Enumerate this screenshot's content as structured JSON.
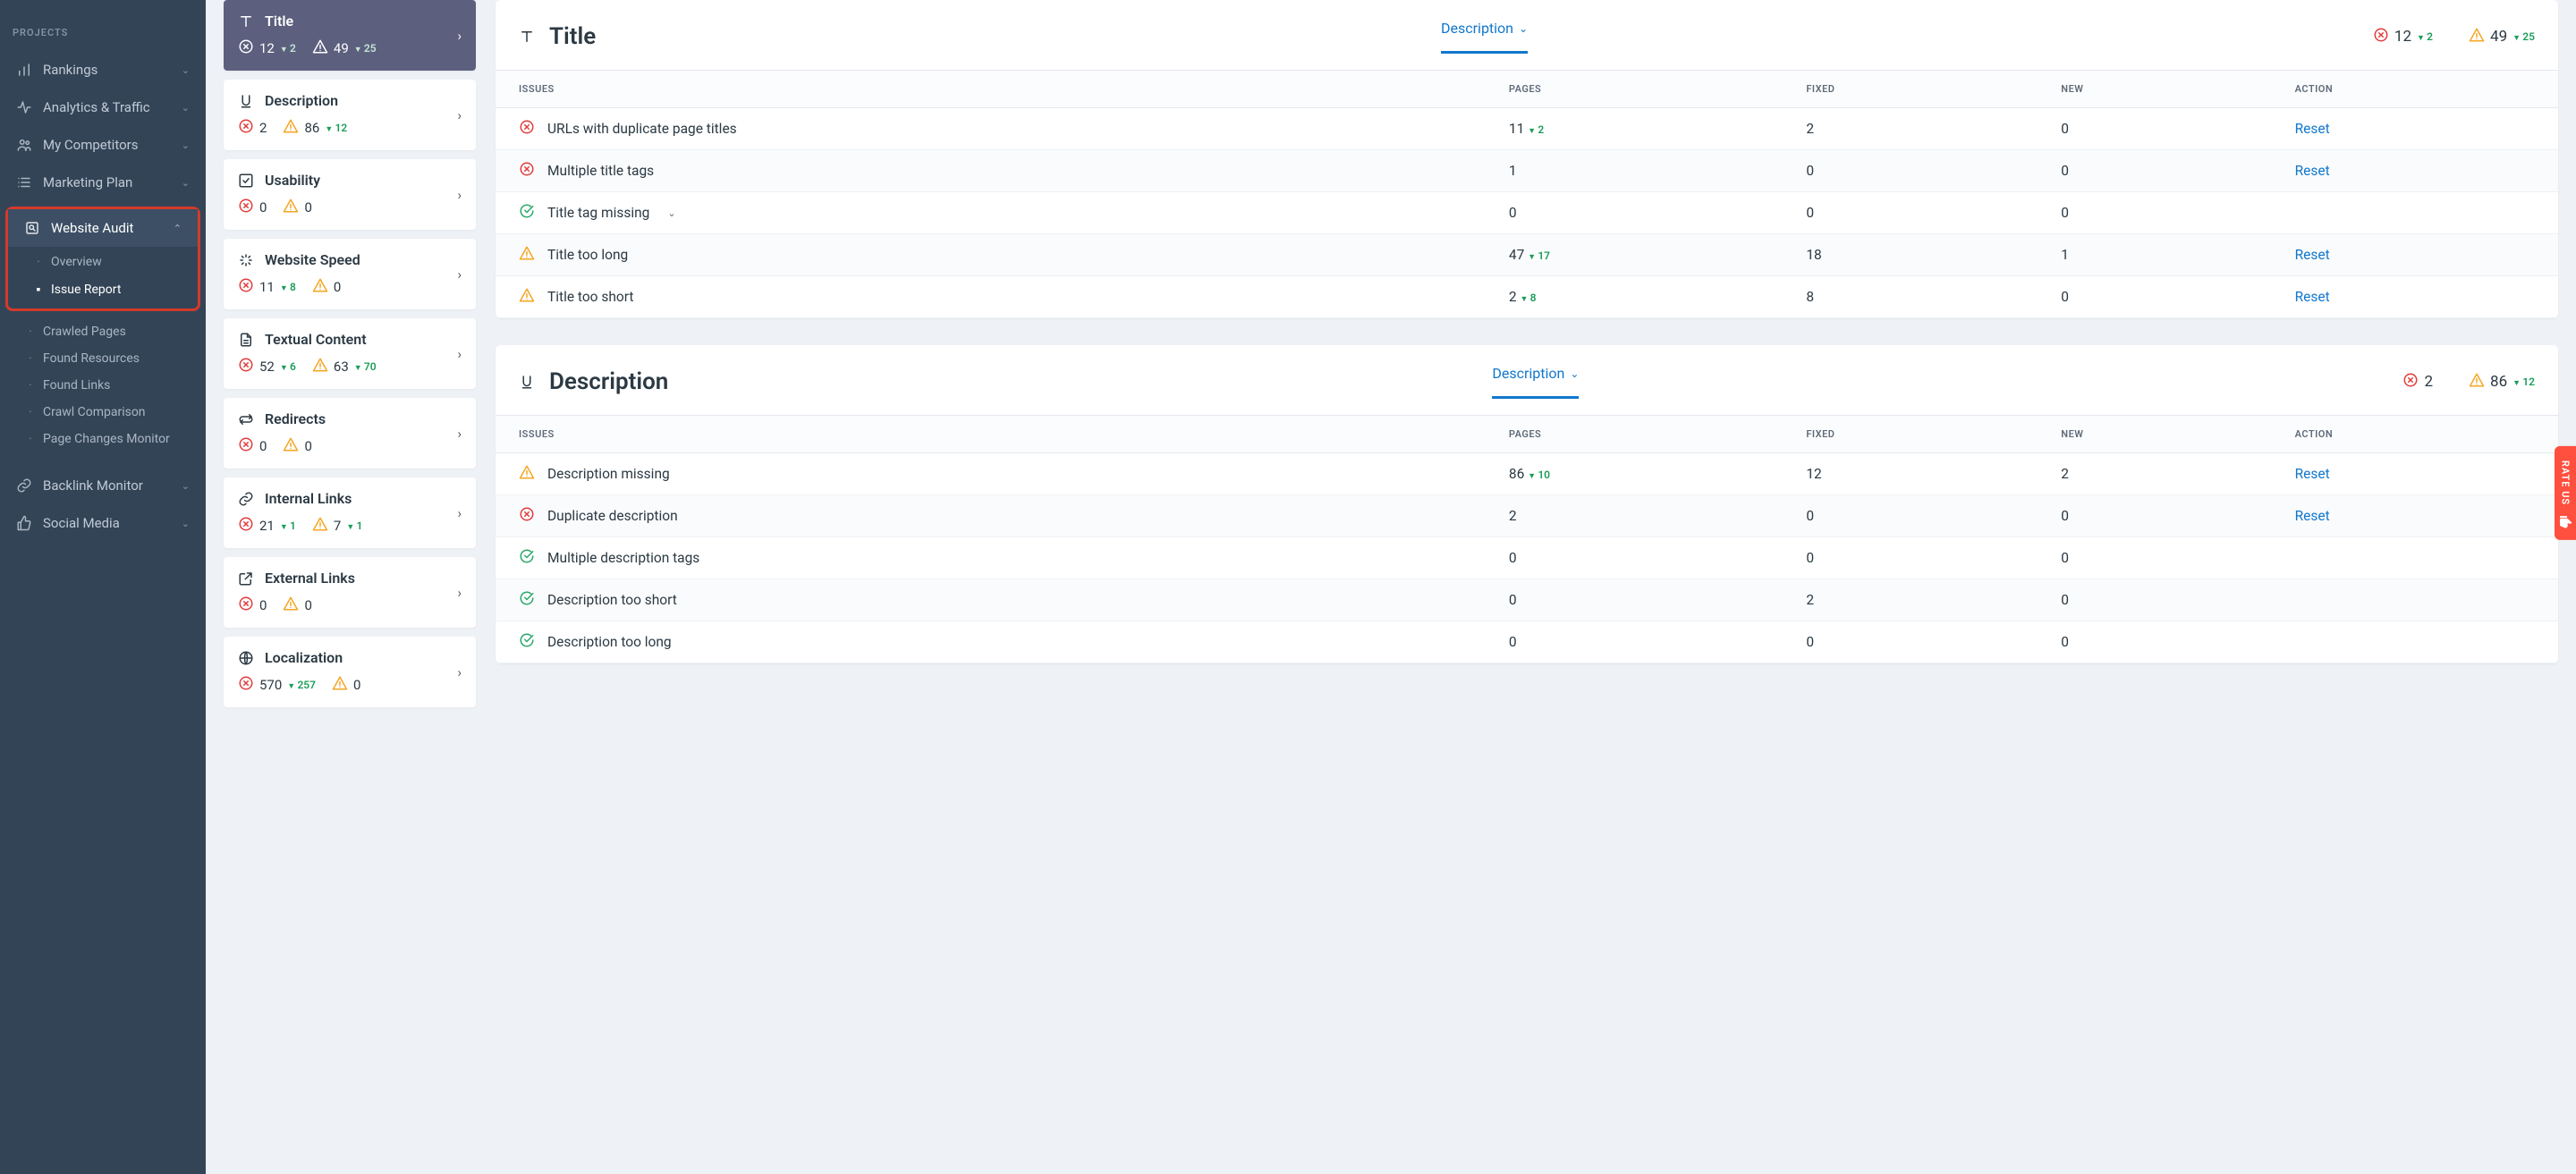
{
  "sidebar": {
    "heading": "PROJECTS",
    "items": [
      {
        "label": "Rankings",
        "icon": "bars"
      },
      {
        "label": "Analytics & Traffic",
        "icon": "pulse"
      },
      {
        "label": "My Competitors",
        "icon": "people"
      },
      {
        "label": "Marketing Plan",
        "icon": "list"
      },
      {
        "label": "Website Audit",
        "icon": "audit",
        "expanded": true,
        "active": true
      },
      {
        "label": "Backlink Monitor",
        "icon": "link"
      },
      {
        "label": "Social Media",
        "icon": "thumb"
      }
    ],
    "audit_sub": [
      {
        "label": "Overview"
      },
      {
        "label": "Issue Report",
        "selected": true
      },
      {
        "label": "Crawled Pages"
      },
      {
        "label": "Found Resources"
      },
      {
        "label": "Found Links"
      },
      {
        "label": "Crawl Comparison"
      },
      {
        "label": "Page Changes Monitor"
      }
    ]
  },
  "categories": [
    {
      "key": "title",
      "icon": "T",
      "title": "Title",
      "err": 12,
      "err_d": 2,
      "warn": 49,
      "warn_d": 25,
      "active": true
    },
    {
      "key": "description",
      "icon": "U",
      "title": "Description",
      "err": 2,
      "warn": 86,
      "warn_d": 12
    },
    {
      "key": "usability",
      "icon": "check",
      "title": "Usability",
      "err": 0,
      "warn": 0
    },
    {
      "key": "speed",
      "icon": "speed",
      "title": "Website Speed",
      "err": 11,
      "err_d": 8,
      "warn": 0
    },
    {
      "key": "text",
      "icon": "doc",
      "title": "Textual Content",
      "err": 52,
      "err_d": 6,
      "warn": 63,
      "warn_d": 70
    },
    {
      "key": "redirects",
      "icon": "redir",
      "title": "Redirects",
      "err": 0,
      "warn": 0
    },
    {
      "key": "ilinks",
      "icon": "link",
      "title": "Internal Links",
      "err": 21,
      "err_d": 1,
      "warn": 7,
      "warn_d": 1
    },
    {
      "key": "elinks",
      "icon": "ext",
      "title": "External Links",
      "err": 0,
      "warn": 0
    },
    {
      "key": "local",
      "icon": "globe",
      "title": "Localization",
      "err": 570,
      "err_d": 257,
      "warn": 0
    }
  ],
  "sections": [
    {
      "title": "Title",
      "icon": "T",
      "tab": "Description",
      "stats": {
        "err": 12,
        "err_d": 2,
        "warn": 49,
        "warn_d": 25
      },
      "columns": [
        "ISSUES",
        "PAGES",
        "FIXED",
        "NEW",
        "ACTION"
      ],
      "rows": [
        {
          "sev": "err",
          "name": "URLs with duplicate page titles",
          "pages": "11",
          "pages_d": 2,
          "fixed": "2",
          "new": "0",
          "action": "Reset"
        },
        {
          "sev": "err",
          "name": "Multiple title tags",
          "pages": "1",
          "fixed": "0",
          "new": "0",
          "action": "Reset"
        },
        {
          "sev": "ok",
          "name": "Title tag missing",
          "expandable": true,
          "pages": "0",
          "fixed": "0",
          "new": "0",
          "action": ""
        },
        {
          "sev": "warn",
          "name": "Title too long",
          "pages": "47",
          "pages_d": 17,
          "fixed": "18",
          "new": "1",
          "action": "Reset"
        },
        {
          "sev": "warn",
          "name": "Title too short",
          "pages": "2",
          "pages_d": 8,
          "fixed": "8",
          "new": "0",
          "action": "Reset"
        }
      ]
    },
    {
      "title": "Description",
      "icon": "U",
      "tab": "Description",
      "stats": {
        "err": 2,
        "warn": 86,
        "warn_d": 12
      },
      "columns": [
        "ISSUES",
        "PAGES",
        "FIXED",
        "NEW",
        "ACTION"
      ],
      "rows": [
        {
          "sev": "warn",
          "name": "Description missing",
          "pages": "86",
          "pages_d": 10,
          "fixed": "12",
          "new": "2",
          "action": "Reset"
        },
        {
          "sev": "err",
          "name": "Duplicate description",
          "pages": "2",
          "fixed": "0",
          "new": "0",
          "action": "Reset"
        },
        {
          "sev": "ok",
          "name": "Multiple description tags",
          "pages": "0",
          "fixed": "0",
          "new": "0",
          "action": ""
        },
        {
          "sev": "ok",
          "name": "Description too short",
          "pages": "0",
          "fixed": "2",
          "new": "0",
          "action": ""
        },
        {
          "sev": "ok",
          "name": "Description too long",
          "pages": "0",
          "fixed": "0",
          "new": "0",
          "action": ""
        }
      ]
    }
  ],
  "rateus": "RATE US"
}
